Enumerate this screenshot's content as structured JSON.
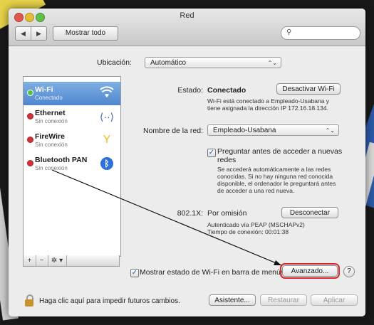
{
  "window": {
    "title": "Red"
  },
  "toolbar": {
    "back": "◀",
    "forward": "▶",
    "show_all": "Mostrar todo",
    "search_placeholder": ""
  },
  "location": {
    "label": "Ubicación:",
    "value": "Automático"
  },
  "services": [
    {
      "name": "Wi-Fi",
      "status": "Conectado",
      "icon": "wifi-icon",
      "dot": "green",
      "selected": true
    },
    {
      "name": "Ethernet",
      "status": "Sin conexión",
      "icon": "ethernet-icon",
      "dot": "red"
    },
    {
      "name": "FireWire",
      "status": "Sin conexión",
      "icon": "firewire-icon",
      "dot": "red"
    },
    {
      "name": "Bluetooth PAN",
      "status": "Sin conexión",
      "icon": "bluetooth-icon",
      "dot": "red"
    }
  ],
  "sidebar_buttons": {
    "add": "+",
    "remove": "−",
    "gear": "✲ ▾"
  },
  "detail": {
    "status_label": "Estado:",
    "status_value": "Conectado",
    "turn_off_button": "Desactivar Wi-Fi",
    "status_desc_1": "Wi-Fi está conectado a Empleado-Usabana y",
    "status_desc_2": "tiene asignada la dirección IP 172.16.18.134.",
    "network_label": "Nombre de la red:",
    "network_value": "Empleado-Usabana",
    "ask_label_1": "Preguntar antes de acceder a nuevas",
    "ask_label_2": "redes",
    "ask_desc_1": "Se accederá automáticamente a las redes",
    "ask_desc_2": "conocidas. Si no hay ninguna red conocida",
    "ask_desc_3": "disponible, el ordenador le preguntará antes",
    "ask_desc_4": "de acceder a una red nueva.",
    "auth_label": "802.1X:",
    "auth_value": "Por omisión",
    "disconnect_button": "Desconectar",
    "auth_desc_1": "Autenticado vía PEAP (MSCHAPv2)",
    "auth_desc_2": "Tiempo de conexión: 00:01:38"
  },
  "show_status_label": "Mostrar estado de Wi-Fi en barra de menús",
  "advanced_button": "Avanzado...",
  "help_button": "?",
  "footer": {
    "lock_text": "Haga clic aquí para impedir futuros cambios.",
    "assistant_button": "Asistente...",
    "restore_button": "Restaurar",
    "apply_button": "Aplicar"
  },
  "colors": {
    "selection": "#5a8fd4",
    "highlight_box": "#d9262c",
    "annotation_arrow": "#111111"
  }
}
